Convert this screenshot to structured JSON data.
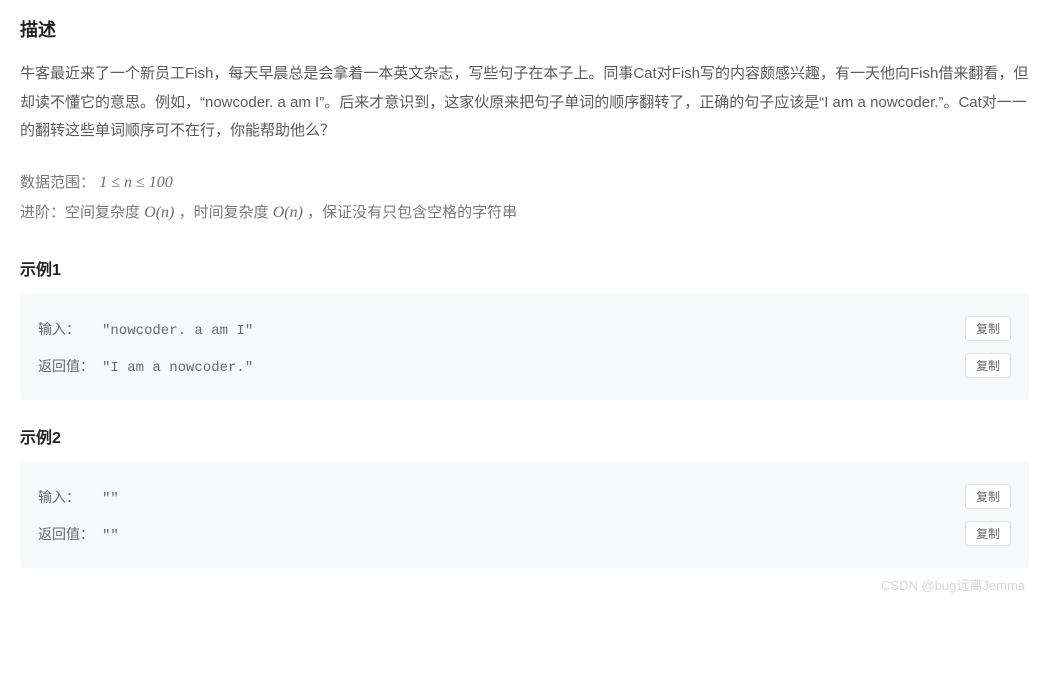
{
  "sections": {
    "description": {
      "title": "描述",
      "body": "牛客最近来了一个新员工Fish，每天早晨总是会拿着一本英文杂志，写些句子在本子上。同事Cat对Fish写的内容颇感兴趣，有一天他向Fish借来翻看，但却读不懂它的意思。例如，“nowcoder. a am I”。后来才意识到，这家伙原来把句子单词的顺序翻转了，正确的句子应该是“I am a nowcoder.”。Cat对一一的翻转这些单词顺序可不在行，你能帮助他么？",
      "range_prefix": "数据范围：",
      "range_math": "1 ≤ n ≤ 100",
      "advance_prefix": "进阶：空间复杂度 ",
      "advance_m1": "O(n)",
      "advance_sep": " ，时间复杂度 ",
      "advance_m2": "O(n)",
      "advance_suffix": " ，保证没有只包含空格的字符串"
    },
    "example1": {
      "title": "示例1",
      "input_label": "输入：",
      "input_value": "\"nowcoder. a am I\"",
      "output_label": "返回值：",
      "output_value": "\"I am a nowcoder.\""
    },
    "example2": {
      "title": "示例2",
      "input_label": "输入：",
      "input_value": "\"\"",
      "output_label": "返回值：",
      "output_value": "\"\""
    }
  },
  "ui": {
    "copy_label": "复制"
  },
  "watermark": "CSDN @bug远离Jemma"
}
